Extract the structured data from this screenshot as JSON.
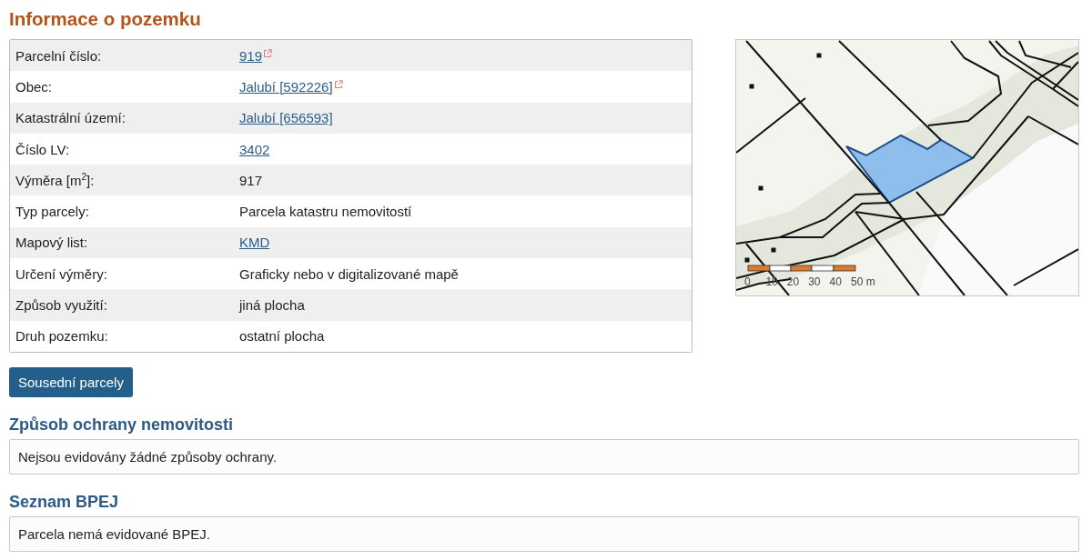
{
  "title": "Informace o pozemku",
  "parcel_table": {
    "rows": [
      {
        "label": "Parcelní číslo:",
        "value": "919",
        "kind": "link",
        "external": true
      },
      {
        "label": "Obec:",
        "value": "Jalubí [592226]",
        "kind": "link",
        "external": true
      },
      {
        "label": "Katastrální území:",
        "value": "Jalubí [656593]",
        "kind": "link",
        "external": false
      },
      {
        "label": "Číslo LV:",
        "value": "3402",
        "kind": "link",
        "external": false
      },
      {
        "label": "Výměra [m$^{2}$]:",
        "value": "917",
        "kind": "text",
        "external": false
      },
      {
        "label": "Typ parcely:",
        "value": "Parcela katastru nemovitostí",
        "kind": "text",
        "external": false
      },
      {
        "label": "Mapový list:",
        "value": "KMD",
        "kind": "link",
        "external": false
      },
      {
        "label": "Určení výměry:",
        "value": "Graficky nebo v digitalizované mapě",
        "kind": "text",
        "external": false
      },
      {
        "label": "Způsob využití:",
        "value": "jiná plocha",
        "kind": "text",
        "external": false
      },
      {
        "label": "Druh pozemku:",
        "value": "ostatní plocha",
        "kind": "text",
        "external": false
      }
    ]
  },
  "map": {
    "scale_labels": [
      "0",
      "10",
      "20",
      "30",
      "40",
      "50 m"
    ]
  },
  "neighbours_button": "Sousední parcely",
  "sections": [
    {
      "heading": "Způsob ochrany nemovitosti",
      "text": "Nejsou evidovány žádné způsoby ochrany."
    },
    {
      "heading": "Seznam BPEJ",
      "text": "Parcela nemá evidované BPEJ."
    }
  ]
}
